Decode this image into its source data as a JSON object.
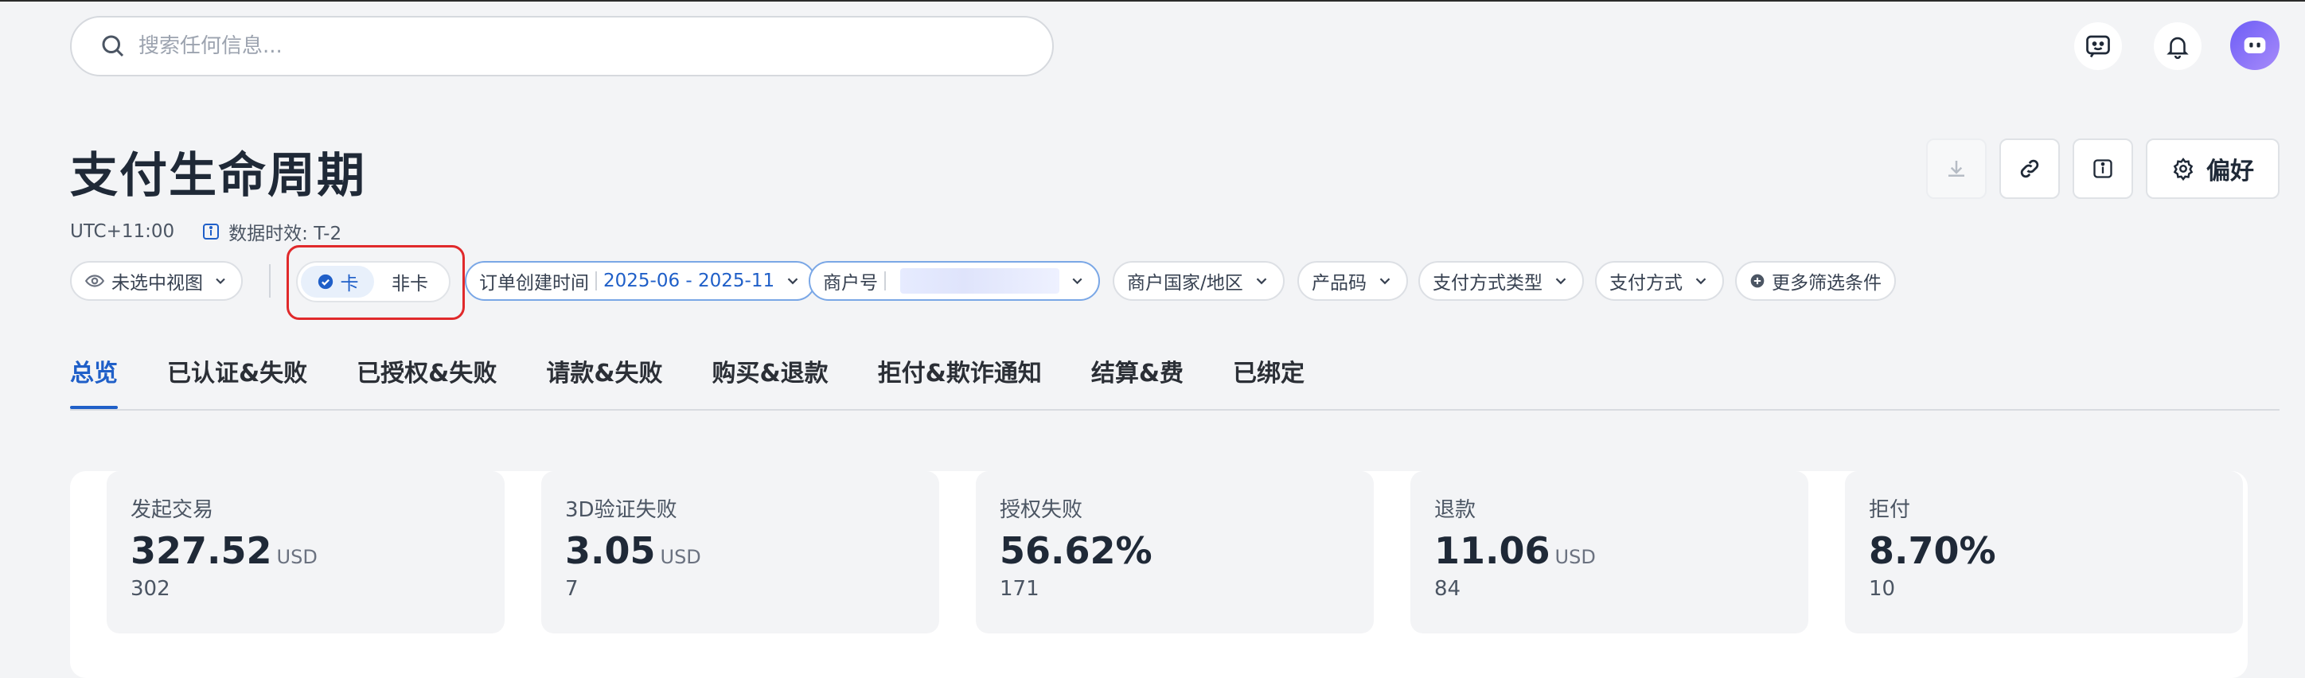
{
  "search": {
    "placeholder": "搜索任何信息..."
  },
  "header_icons": [
    "feedback-icon",
    "bell-icon",
    "avatar"
  ],
  "page": {
    "title": "支付生命周期",
    "timezone": "UTC+11:00",
    "data_freshness": "数据时效: T-2"
  },
  "toolbar": {
    "preferences_label": "偏好"
  },
  "filters": {
    "view": "未选中视图",
    "card_toggle": {
      "active": "卡",
      "inactive": "非卡"
    },
    "order_time": {
      "label": "订单创建时间",
      "value": "2025-06 - 2025-11"
    },
    "merchant_id": {
      "label": "商户号"
    },
    "merchant_country": "商户国家/地区",
    "product_code": "产品码",
    "payment_method_type": "支付方式类型",
    "payment_method": "支付方式",
    "more_filters": "更多筛选条件"
  },
  "tabs": [
    {
      "label": "总览",
      "active": true
    },
    {
      "label": "已认证&失败"
    },
    {
      "label": "已授权&失败"
    },
    {
      "label": "请款&失败"
    },
    {
      "label": "购买&退款"
    },
    {
      "label": "拒付&欺诈通知"
    },
    {
      "label": "结算&费"
    },
    {
      "label": "已绑定"
    }
  ],
  "metrics": [
    {
      "label": "发起交易",
      "value": "327.52",
      "unit": "USD",
      "count": "302"
    },
    {
      "label": "3D验证失败",
      "value": "3.05",
      "unit": "USD",
      "count": "7"
    },
    {
      "label": "授权失败",
      "value": "56.62%",
      "unit": "",
      "count": "171"
    },
    {
      "label": "退款",
      "value": "11.06",
      "unit": "USD",
      "count": "84"
    },
    {
      "label": "拒付",
      "value": "8.70%",
      "unit": "",
      "count": "10"
    }
  ],
  "colors": {
    "accent": "#1f5fc8",
    "highlight": "#e0292b"
  }
}
